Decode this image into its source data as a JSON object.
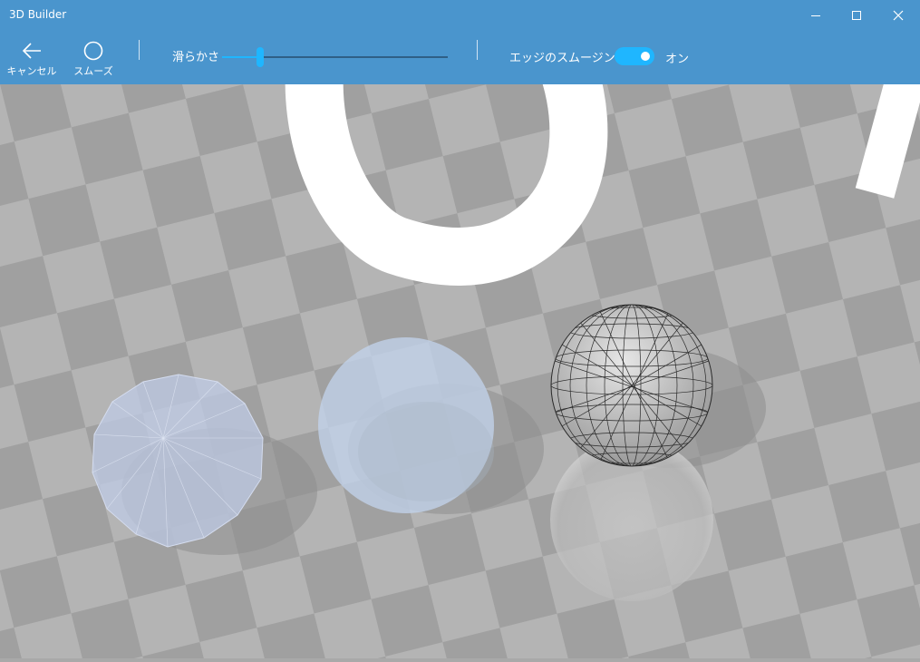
{
  "window": {
    "title": "3D Builder"
  },
  "toolbar": {
    "cancel_label": "キャンセル",
    "smooth_label": "スムーズ",
    "smoothness_label": "滑らかさ",
    "smoothness_value": 0.17,
    "edge_smoothing_label": "エッジのスムージング",
    "edge_smoothing_state": "オン",
    "edge_smoothing_on": true
  },
  "icons": {
    "minimize": "minimize-icon",
    "maximize": "maximize-icon",
    "close": "close-icon",
    "cancel": "arrow-left-icon",
    "smooth": "circle-icon"
  },
  "colors": {
    "chrome": "#4a95cd",
    "accent": "#1fb6ff",
    "floor_light": "#b4b4b4",
    "floor_dark": "#a0a0a0"
  }
}
